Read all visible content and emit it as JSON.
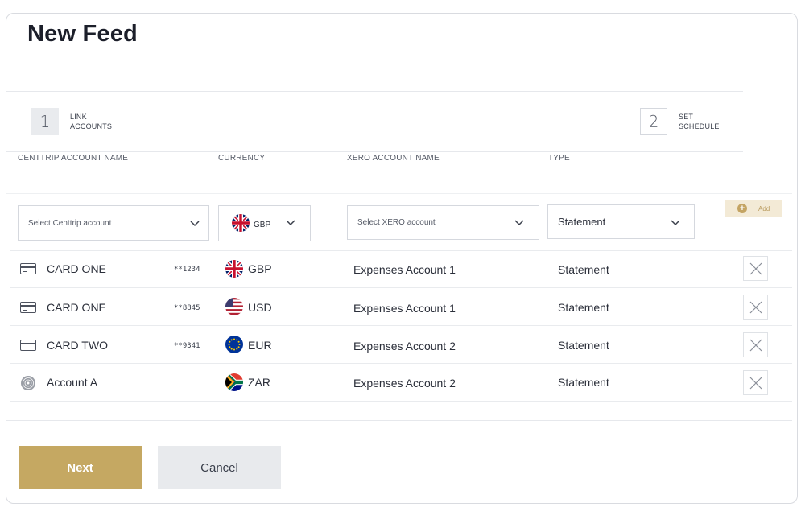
{
  "page": {
    "title": "New Feed"
  },
  "stepper": {
    "steps": [
      {
        "number": "1",
        "line1": "LINK",
        "line2": "ACCOUNTS"
      },
      {
        "number": "2",
        "line1": "SET",
        "line2": "SCHEDULE"
      }
    ]
  },
  "columns": {
    "account_name": "CENTTRIP ACCOUNT NAME",
    "currency": "CURRENCY",
    "xero_account": "XERO ACCOUNT NAME",
    "type": "TYPE"
  },
  "form": {
    "centtrip_select_placeholder": "Select Centtrip account",
    "currency_value": "GBP",
    "xero_select_placeholder": "Select XERO account",
    "type_value": "Statement",
    "add_label": "Add"
  },
  "rows": [
    {
      "icon": "card-icon",
      "name": "CARD ONE",
      "masked": "**1234",
      "flag": "uk-flag-icon",
      "currency": "GBP",
      "xero": "Expenses Account 1",
      "type": "Statement"
    },
    {
      "icon": "card-icon",
      "name": "CARD ONE",
      "masked": "**8845",
      "flag": "us-flag-icon",
      "currency": "USD",
      "xero": "Expenses Account 1",
      "type": "Statement"
    },
    {
      "icon": "card-icon",
      "name": "CARD TWO",
      "masked": "**9341",
      "flag": "eu-flag-icon",
      "currency": "EUR",
      "xero": "Expenses Account 2",
      "type": "Statement"
    },
    {
      "icon": "account-icon",
      "name": "Account A",
      "masked": "",
      "flag": "za-flag-icon",
      "currency": "ZAR",
      "xero": "Expenses Account 2",
      "type": "Statement"
    }
  ],
  "actions": {
    "next": "Next",
    "cancel": "Cancel"
  },
  "colors": {
    "accent": "#c5a862",
    "accent_light": "#f3ead6"
  }
}
